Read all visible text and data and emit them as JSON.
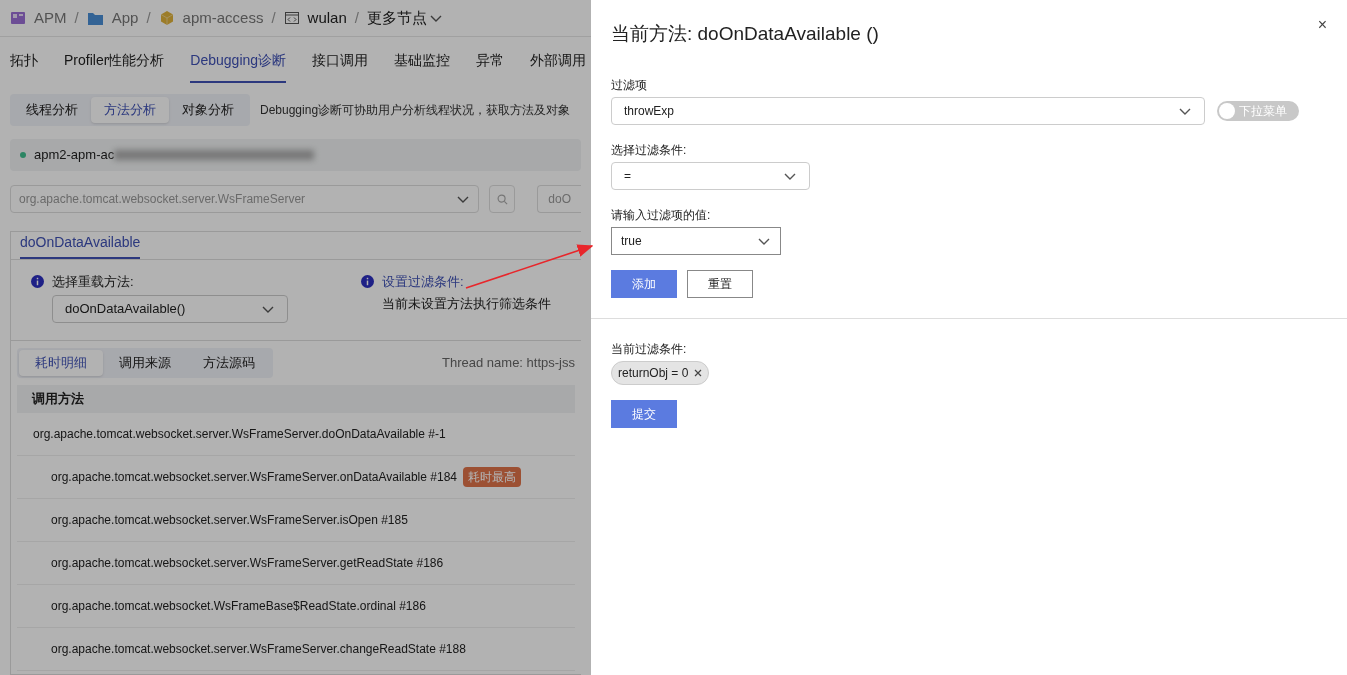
{
  "breadcrumb": [
    {
      "text": "APM",
      "kind": "app"
    },
    {
      "text": "App",
      "kind": "folder"
    },
    {
      "text": "apm-access",
      "kind": "cube"
    },
    {
      "text": "wulan",
      "kind": "code"
    }
  ],
  "breadcrumb_separator": "/",
  "more_nodes": "更多节点",
  "nav_tabs": [
    {
      "label": "拓扑",
      "selected": false
    },
    {
      "label": "Profiler性能分析",
      "selected": false
    },
    {
      "label": "Debugging诊断",
      "selected": true
    },
    {
      "label": "接口调用",
      "selected": false
    },
    {
      "label": "基础监控",
      "selected": false
    },
    {
      "label": "异常",
      "selected": false
    },
    {
      "label": "外部调用",
      "selected": false
    }
  ],
  "sub_tabs": [
    {
      "label": "线程分析",
      "selected": false
    },
    {
      "label": "方法分析",
      "selected": true
    },
    {
      "label": "对象分析",
      "selected": false
    }
  ],
  "description": "Debugging诊断可协助用户分析线程状况，获取方法及对象",
  "instance": {
    "name": "apm2-apm-ac"
  },
  "class_select": {
    "placeholder": "org.apache.tomcat.websocket.server.WsFrameServer"
  },
  "method_field": {
    "placeholder": "doO"
  },
  "method_tabs": [
    {
      "label": "doOnDataAvailable",
      "selected": true
    }
  ],
  "overload": {
    "label": "选择重载方法:",
    "value": "doOnDataAvailable()"
  },
  "filter_info": {
    "label": "设置过滤条件:",
    "text": "当前未设置方法执行筛选条件"
  },
  "detail_tabs": [
    {
      "label": "耗时明细",
      "selected": true
    },
    {
      "label": "调用来源",
      "selected": false
    },
    {
      "label": "方法源码",
      "selected": false
    }
  ],
  "thread_name": "Thread name: https-jss",
  "table": {
    "column": "调用方法",
    "rows": [
      {
        "method": "org.apache.tomcat.websocket.server.WsFrameServer.doOnDataAvailable #-1",
        "children": [
          {
            "method": "org.apache.tomcat.websocket.server.WsFrameServer.onDataAvailable #184",
            "badge": "耗时最高"
          },
          {
            "method": "org.apache.tomcat.websocket.server.WsFrameServer.isOpen #185"
          },
          {
            "method": "org.apache.tomcat.websocket.server.WsFrameServer.getReadState #186"
          },
          {
            "method": "org.apache.tomcat.websocket.WsFrameBase$ReadState.ordinal #186"
          },
          {
            "method": "org.apache.tomcat.websocket.server.WsFrameServer.changeReadState #188"
          }
        ]
      }
    ]
  },
  "drawer": {
    "title": "当前方法: doOnDataAvailable ()",
    "close": "×",
    "filter_item": {
      "label": "过滤项",
      "value": "throwExp"
    },
    "toggle": {
      "label": "下拉菜单",
      "on": false
    },
    "condition": {
      "label": "选择过滤条件:",
      "value": "="
    },
    "value_field": {
      "label": "请输入过滤项的值:",
      "value": "true"
    },
    "add_button": "添加",
    "reset_button": "重置",
    "current": {
      "label": "当前过滤条件:",
      "tags": [
        {
          "text": "returnObj = 0"
        }
      ]
    },
    "submit_button": "提交"
  }
}
